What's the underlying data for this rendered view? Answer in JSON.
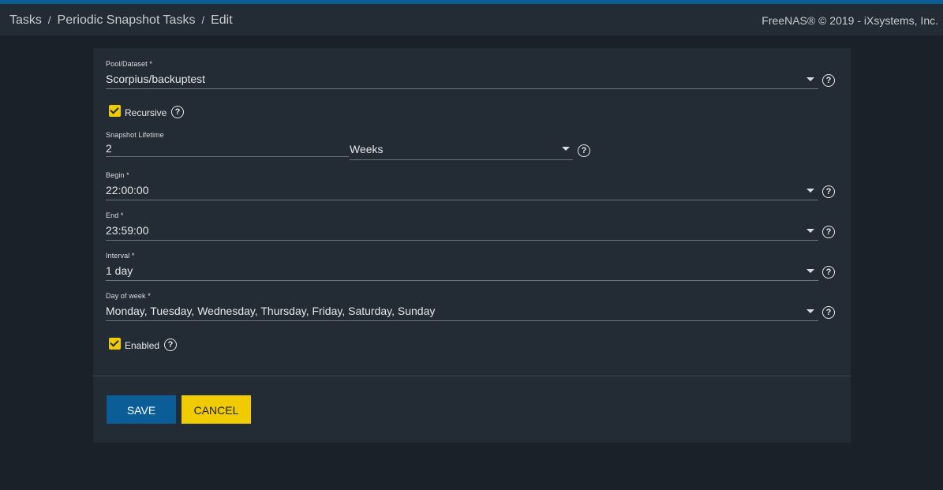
{
  "breadcrumb": {
    "items": [
      "Tasks",
      "Periodic Snapshot Tasks",
      "Edit"
    ],
    "separator": "/"
  },
  "copyright": "FreeNAS® © 2019 - iXsystems, Inc.",
  "form": {
    "pool_dataset": {
      "label": "Pool/Dataset *",
      "value": "Scorpius/backuptest"
    },
    "recursive": {
      "label": "Recursive",
      "checked": true
    },
    "snapshot_lifetime": {
      "label": "Snapshot Lifetime",
      "value": "2",
      "unit": "Weeks"
    },
    "begin": {
      "label": "Begin *",
      "value": "22:00:00"
    },
    "end": {
      "label": "End *",
      "value": "23:59:00"
    },
    "interval": {
      "label": "Interval *",
      "value": "1 day"
    },
    "day_of_week": {
      "label": "Day of week *",
      "value": "Monday, Tuesday, Wednesday, Thursday, Friday, Saturday, Sunday"
    },
    "enabled": {
      "label": "Enabled",
      "checked": true
    }
  },
  "buttons": {
    "save": "SAVE",
    "cancel": "CANCEL"
  },
  "icons": {
    "help": "?"
  },
  "colors": {
    "accent": "#0b5d97",
    "checkbox": "#f0cb00",
    "card": "#232b34",
    "background": "#1b2129"
  }
}
